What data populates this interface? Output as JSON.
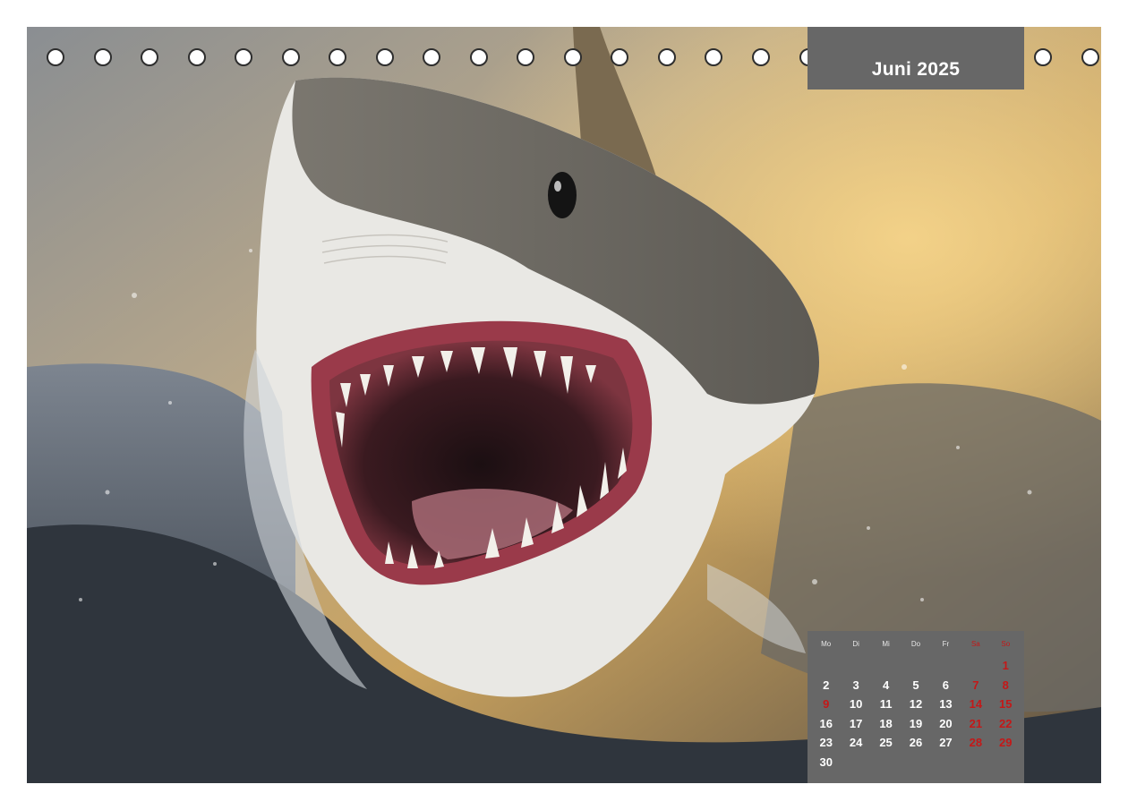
{
  "month_title": "Juni 2025",
  "weekdays": [
    "Mo",
    "Di",
    "Mi",
    "Do",
    "Fr",
    "Sa",
    "So"
  ],
  "weeks": [
    [
      "",
      "",
      "",
      "",
      "",
      "",
      "1"
    ],
    [
      "2",
      "3",
      "4",
      "5",
      "6",
      "7",
      "8"
    ],
    [
      "9",
      "10",
      "11",
      "12",
      "13",
      "14",
      "15"
    ],
    [
      "16",
      "17",
      "18",
      "19",
      "20",
      "21",
      "22"
    ],
    [
      "23",
      "24",
      "25",
      "26",
      "27",
      "28",
      "29"
    ],
    [
      "30",
      "",
      "",
      "",
      "",
      "",
      ""
    ]
  ],
  "holiday_dates": [
    "9"
  ],
  "colors": {
    "panel": "#676767",
    "weekend": "#c41818",
    "text": "#ffffff"
  },
  "photo": {
    "subject": "great white shark with open jaws breaching the water"
  },
  "binding_hole_count": 23
}
